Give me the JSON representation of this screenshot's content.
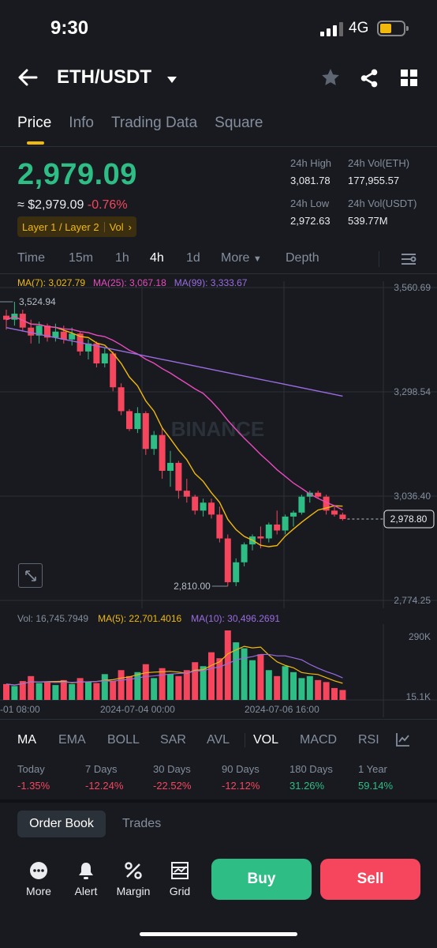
{
  "status_bar": {
    "time": "9:30",
    "network": "4G"
  },
  "header": {
    "pair": "ETH/USDT"
  },
  "tabs": [
    "Price",
    "Info",
    "Trading Data",
    "Square"
  ],
  "ticker": {
    "last_price": "2,979.09",
    "fiat_price": "≈ $2,979.09",
    "change_pct": "-0.76%",
    "tags": "Layer 1 / Layer 2",
    "tag_vol": "Vol",
    "high_label": "24h High",
    "high_value": "3,081.78",
    "vol_eth_label": "24h Vol(ETH)",
    "vol_eth_value": "177,955.57",
    "low_label": "24h Low",
    "low_value": "2,972.63",
    "vol_usdt_label": "24h Vol(USDT)",
    "vol_usdt_value": "539.77M"
  },
  "intervals": [
    "Time",
    "15m",
    "1h",
    "4h",
    "1d",
    "More",
    "Depth"
  ],
  "active_interval": "4h",
  "ma": {
    "ma7": "MA(7): 3,027.79",
    "ma25": "MA(25): 3,067.18",
    "ma99": "MA(99): 3,333.67"
  },
  "watermark": "BINANCE",
  "colors": {
    "up": "#2ebd85",
    "down": "#f6465d",
    "ma7": "#f0b90b",
    "ma25": "#e94bbd",
    "ma99": "#9a6ce0",
    "accent": "#f0b90b"
  },
  "chart_data": {
    "type": "candlestick",
    "y_ticks": [
      "3,560.69",
      "3,298.54",
      "3,036.40",
      "2,774.25"
    ],
    "ylim": [
      2774.25,
      3560.69
    ],
    "high_marker": "3,524.94",
    "low_marker": "2,810.00",
    "current_price_label": "2,978.80",
    "candles": [
      [
        3490,
        3505,
        3455,
        3480
      ],
      [
        3480,
        3524.94,
        3465,
        3495
      ],
      [
        3495,
        3505,
        3450,
        3460
      ],
      [
        3460,
        3480,
        3420,
        3440
      ],
      [
        3440,
        3475,
        3420,
        3465
      ],
      [
        3465,
        3470,
        3425,
        3435
      ],
      [
        3435,
        3470,
        3425,
        3450
      ],
      [
        3450,
        3465,
        3420,
        3430
      ],
      [
        3430,
        3460,
        3415,
        3445
      ],
      [
        3445,
        3450,
        3390,
        3400
      ],
      [
        3400,
        3430,
        3380,
        3420
      ],
      [
        3420,
        3425,
        3360,
        3370
      ],
      [
        3370,
        3410,
        3360,
        3395
      ],
      [
        3395,
        3400,
        3300,
        3310
      ],
      [
        3310,
        3320,
        3240,
        3250
      ],
      [
        3250,
        3255,
        3200,
        3205
      ],
      [
        3205,
        3260,
        3195,
        3245
      ],
      [
        3245,
        3250,
        3140,
        3155
      ],
      [
        3155,
        3200,
        3140,
        3190
      ],
      [
        3190,
        3210,
        3080,
        3100
      ],
      [
        3100,
        3150,
        3060,
        3120
      ],
      [
        3120,
        3125,
        3030,
        3050
      ],
      [
        3050,
        3080,
        3020,
        3035
      ],
      [
        3035,
        3040,
        2990,
        3000
      ],
      [
        3000,
        3030,
        2985,
        3020
      ],
      [
        3020,
        3030,
        2980,
        2990
      ],
      [
        2990,
        3010,
        2920,
        2930
      ],
      [
        2930,
        2940,
        2810,
        2820
      ],
      [
        2820,
        2880,
        2810,
        2870
      ],
      [
        2870,
        2920,
        2860,
        2915
      ],
      [
        2915,
        2940,
        2900,
        2935
      ],
      [
        2935,
        2960,
        2905,
        2930
      ],
      [
        2930,
        2970,
        2920,
        2965
      ],
      [
        2965,
        3000,
        2940,
        2950
      ],
      [
        2950,
        2990,
        2940,
        2985
      ],
      [
        2985,
        3000,
        2960,
        2995
      ],
      [
        2995,
        3040,
        2990,
        3035
      ],
      [
        3035,
        3050,
        3020,
        3045
      ],
      [
        3045,
        3050,
        3030,
        3035
      ],
      [
        3035,
        3040,
        2990,
        3000
      ],
      [
        3000,
        3010,
        2985,
        2990
      ],
      [
        2990,
        2995,
        2975,
        2978.8
      ]
    ]
  },
  "volume": {
    "vol_label": "Vol: 16,745.7949",
    "ma5_label": "MA(5): 22,701.4016",
    "ma10_label": "MA(10): 30,496.2691",
    "y_ticks": [
      "290K",
      "15.1K"
    ],
    "values": [
      80,
      70,
      95,
      120,
      85,
      90,
      75,
      100,
      80,
      110,
      90,
      85,
      130,
      95,
      150,
      120,
      140,
      180,
      110,
      160,
      130,
      120,
      150,
      190,
      170,
      240,
      210,
      350,
      290,
      260,
      200,
      230,
      150,
      120,
      170,
      140,
      110,
      120,
      100,
      90,
      60,
      50
    ],
    "x_labels": [
      "-01 08:00",
      "2024-07-04 00:00",
      "2024-07-06 16:00"
    ]
  },
  "indicators": [
    "MA",
    "EMA",
    "BOLL",
    "SAR",
    "AVL",
    "VOL",
    "MACD",
    "RSI"
  ],
  "performance": [
    {
      "label": "Today",
      "value": "-1.35%"
    },
    {
      "label": "7 Days",
      "value": "-12.24%"
    },
    {
      "label": "30 Days",
      "value": "-22.52%"
    },
    {
      "label": "90 Days",
      "value": "-12.12%"
    },
    {
      "label": "180 Days",
      "value": "31.26%"
    },
    {
      "label": "1 Year",
      "value": "59.14%"
    }
  ],
  "book_tabs": [
    "Order Book",
    "Trades"
  ],
  "bottom_bar": {
    "more": "More",
    "alert": "Alert",
    "margin": "Margin",
    "grid": "Grid",
    "buy": "Buy",
    "sell": "Sell"
  }
}
